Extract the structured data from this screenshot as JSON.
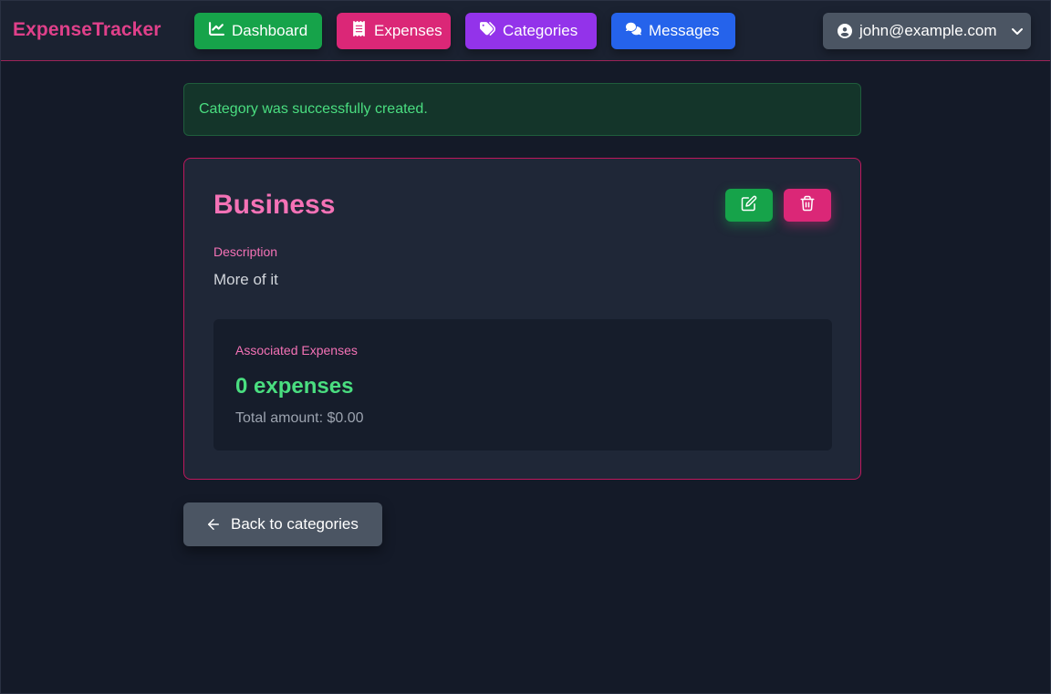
{
  "navbar": {
    "brand": "ExpenseTracker",
    "links": [
      {
        "label": "Dashboard",
        "icon": "chart-line-icon",
        "color": "#16a34a"
      },
      {
        "label": "Expenses",
        "icon": "receipt-icon",
        "color": "#db2777"
      },
      {
        "label": "Categories",
        "icon": "tags-icon",
        "color": "#9333ea"
      },
      {
        "label": "Messages",
        "icon": "comments-icon",
        "color": "#2563eb"
      }
    ],
    "user": {
      "email": "john@example.com",
      "icon": "user-circle-icon",
      "dropdown_icon": "chevron-down-icon"
    }
  },
  "flash": {
    "message": "Category was successfully created.",
    "color": "#4ade80"
  },
  "category": {
    "name": "Business",
    "description_label": "Description",
    "description": "More of it",
    "actions": {
      "edit_icon": "edit-icon",
      "delete_icon": "trash-icon"
    },
    "associated": {
      "label": "Associated Expenses",
      "count_text": "0 expenses",
      "total_text": "Total amount: $0.00"
    }
  },
  "back_button": {
    "label": "Back to categories",
    "icon": "arrow-left-icon"
  },
  "colors": {
    "background": "#141a28",
    "accent_pink": "#f472b6",
    "success_green": "#4ade80"
  }
}
